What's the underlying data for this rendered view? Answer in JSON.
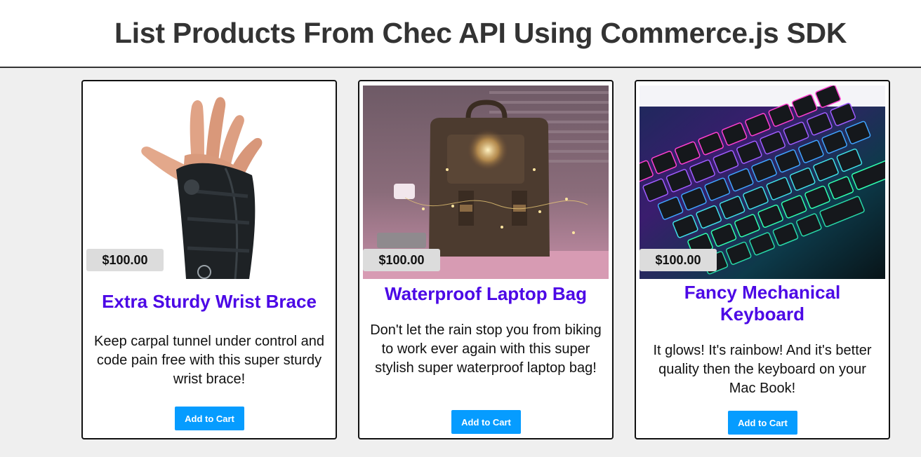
{
  "header": {
    "title": "List Products From Chec API Using Commerce.js SDK"
  },
  "products": [
    {
      "name": "Extra Sturdy Wrist Brace",
      "price": "$100.00",
      "description": "Keep carpal tunnel under control and code pain free with this super sturdy wrist brace!",
      "button_label": "Add to Cart",
      "image": "wrist-brace-photo"
    },
    {
      "name": "Waterproof Laptop Bag",
      "price": "$100.00",
      "description": "Don't let the rain stop you from biking to work ever again with this super stylish super waterproof laptop bag!",
      "button_label": "Add to Cart",
      "image": "laptop-bag-photo"
    },
    {
      "name": "Fancy Mechanical Keyboard",
      "price": "$100.00",
      "description": "It glows! It's rainbow! And it's better quality then the keyboard on your Mac Book!",
      "button_label": "Add to Cart",
      "image": "keyboard-photo"
    }
  ],
  "colors": {
    "product_name": "#4c08e6",
    "button_bg": "#069cff",
    "page_bg": "#efefef",
    "price_badge_bg": "#dcdcdc"
  }
}
